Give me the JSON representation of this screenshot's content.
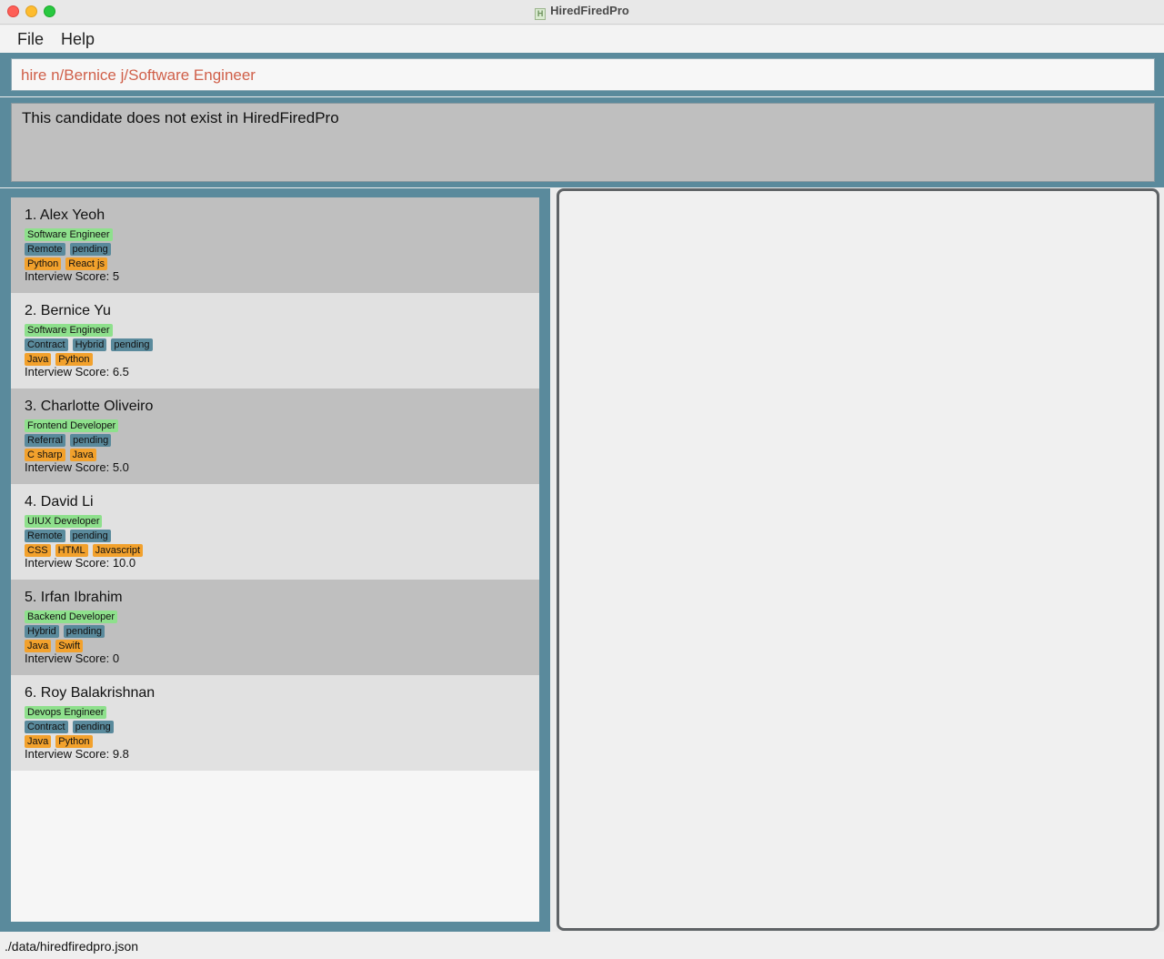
{
  "window": {
    "title": "HiredFiredPro"
  },
  "menu": {
    "file": "File",
    "help": "Help"
  },
  "command": {
    "value": "hire n/Bernice j/Software Engineer"
  },
  "result": {
    "message": "This candidate does not exist in HiredFiredPro"
  },
  "candidates": [
    {
      "name": "1. Alex Yeoh",
      "job": "Software Engineer",
      "status_tags": [
        "Remote",
        "pending"
      ],
      "skill_tags": [
        "Python",
        "React js"
      ],
      "score": "Interview Score: 5"
    },
    {
      "name": "2. Bernice Yu",
      "job": "Software Engineer",
      "status_tags": [
        "Contract",
        "Hybrid",
        "pending"
      ],
      "skill_tags": [
        "Java",
        "Python"
      ],
      "score": "Interview Score: 6.5"
    },
    {
      "name": "3. Charlotte Oliveiro",
      "job": "Frontend Developer",
      "status_tags": [
        "Referral",
        "pending"
      ],
      "skill_tags": [
        "C sharp",
        "Java"
      ],
      "score": "Interview Score: 5.0"
    },
    {
      "name": "4. David Li",
      "job": "UIUX Developer",
      "status_tags": [
        "Remote",
        "pending"
      ],
      "skill_tags": [
        "CSS",
        "HTML",
        "Javascript"
      ],
      "score": "Interview Score: 10.0"
    },
    {
      "name": "5. Irfan Ibrahim",
      "job": "Backend Developer",
      "status_tags": [
        "Hybrid",
        "pending"
      ],
      "skill_tags": [
        "Java",
        "Swift"
      ],
      "score": "Interview Score: 0"
    },
    {
      "name": "6. Roy Balakrishnan",
      "job": "Devops Engineer",
      "status_tags": [
        "Contract",
        "pending"
      ],
      "skill_tags": [
        "Java",
        "Python"
      ],
      "score": "Interview Score: 9.8"
    }
  ],
  "status_bar": {
    "path": "./data/hiredfiredpro.json"
  },
  "colors": {
    "accent_band": "#5a8a9c",
    "job_tag": "#8ee08c",
    "skill_tag": "#f2a12c",
    "command_text": "#d0604a"
  }
}
